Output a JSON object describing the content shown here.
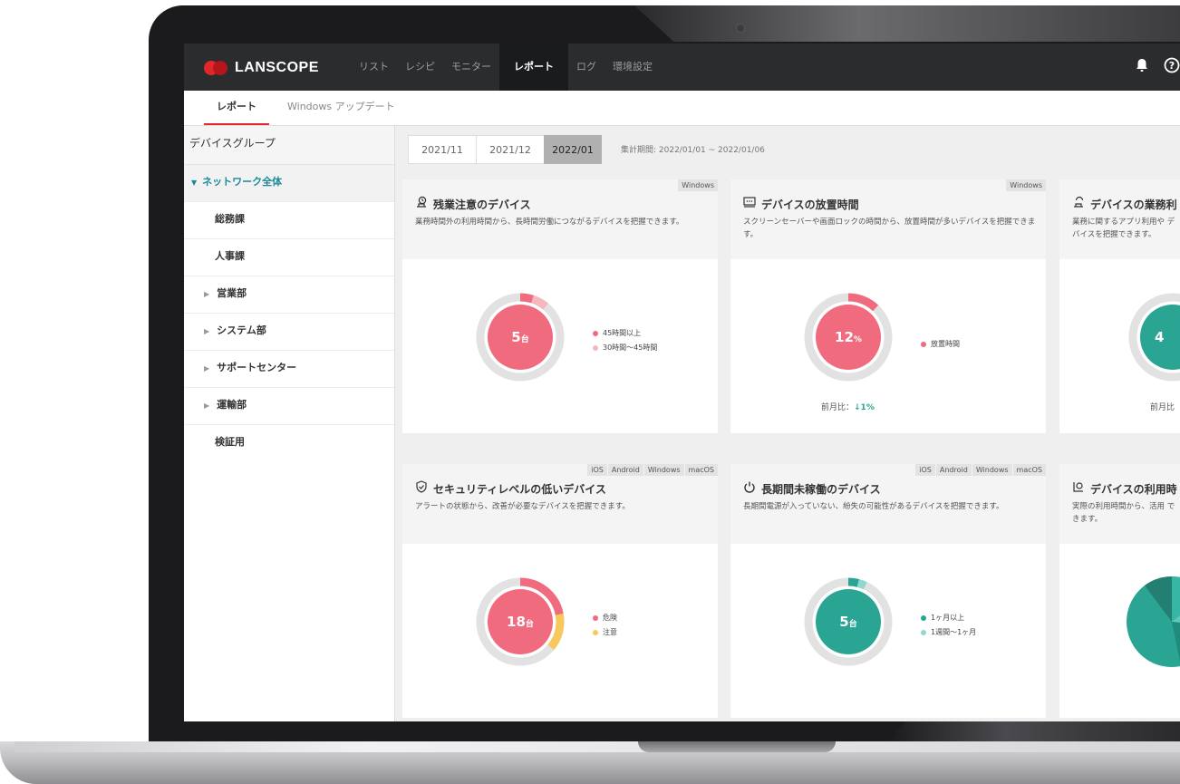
{
  "brand": {
    "name": "LANSCOPE"
  },
  "nav": {
    "items": [
      "リスト",
      "レシピ",
      "モニター",
      "レポート",
      "ログ",
      "環境設定"
    ],
    "active": "レポート"
  },
  "header_icons": [
    "bell-icon",
    "help-icon"
  ],
  "subnav": {
    "tabs": [
      "レポート",
      "Windows アップデート"
    ]
  },
  "sidebar": {
    "heading": "デバイスグループ",
    "root": "ネットワーク全体",
    "items": [
      "総務課",
      "人事課",
      "営業部",
      "システム部",
      "サポートセンター",
      "運輸部",
      "検証用"
    ]
  },
  "periods": {
    "options": [
      "2021/11",
      "2021/12",
      "2022/01"
    ],
    "selected": "2022/01",
    "range_text": "集計期間: 2022/01/01 ~ 2022/01/06"
  },
  "colors": {
    "pink": "#f16b7f",
    "light_pink": "#f6b7bf",
    "teal": "#2aa594",
    "light_teal": "#8ed8d0",
    "yellow": "#f7c95c",
    "ring": "#e2e2e2"
  },
  "cards": [
    {
      "tags": [
        "Windows"
      ],
      "icon": "overtime-clock-icon",
      "title": "残業注意のデバイス",
      "desc": "業務時間外の利用時間から、長時間労働につながるデバイスを把握できます。",
      "center_value": "5",
      "center_unit": "台",
      "legend": [
        "45時間以上",
        "30時間～45時間"
      ],
      "segments": [
        0.05,
        0.06
      ]
    },
    {
      "tags": [
        "Windows"
      ],
      "icon": "screen-idle-icon",
      "title": "デバイスの放置時間",
      "desc": "スクリーンセーバーや画面ロックの時間から、放置時間が多いデバイスを把握できます。",
      "center_value": "12",
      "center_unit": "%",
      "legend": [
        "放置時間"
      ],
      "segments": [
        0.12
      ],
      "compare_label": "前月比：",
      "compare_value": "↓1%"
    },
    {
      "tags": [],
      "icon": "business-usage-icon",
      "title": "デバイスの業務利",
      "desc": "業務に関するアプリ利用や デバイスを把握できます。",
      "center_value": "4",
      "center_unit": "",
      "segments": [
        0.5
      ],
      "compare_label": "前月比"
    },
    {
      "tags": [
        "iOS",
        "Android",
        "Windows",
        "macOS"
      ],
      "icon": "shield-check-icon",
      "title": "セキュリティレベルの低いデバイス",
      "desc": "アラートの状態から、改善が必要なデバイスを把握できます。",
      "center_value": "18",
      "center_unit": "台",
      "legend": [
        "危険",
        "注意"
      ],
      "segments": [
        0.22,
        0.14
      ]
    },
    {
      "tags": [
        "iOS",
        "Android",
        "Windows",
        "macOS"
      ],
      "icon": "power-icon",
      "title": "長期間未稼働のデバイス",
      "desc": "長期間電源が入っていない、紛失の可能性があるデバイスを把握できます。",
      "center_value": "5",
      "center_unit": "台",
      "legend": [
        "1ヶ月以上",
        "1週間～1ヶ月"
      ],
      "segments": [
        0.04,
        0.03
      ]
    },
    {
      "tags": [],
      "icon": "usage-time-icon",
      "title": "デバイスの利用時",
      "desc": "実際の利用時間から、活用 できます。",
      "segments": []
    }
  ]
}
